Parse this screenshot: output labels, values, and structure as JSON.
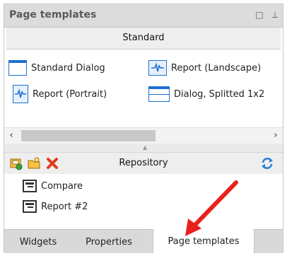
{
  "panel": {
    "title": "Page templates",
    "minimize_glyph": "□",
    "pin_glyph": "⊥"
  },
  "templates": {
    "category": "Standard",
    "items": [
      {
        "label": "Standard Dialog",
        "icon": "dialog-template-icon"
      },
      {
        "label": "Report (Landscape)",
        "icon": "report-landscape-icon"
      },
      {
        "label": "Report (Portrait)",
        "icon": "report-portrait-icon"
      },
      {
        "label": "Dialog, Splitted 1x2",
        "icon": "dialog-split-icon"
      }
    ]
  },
  "scrollbar": {
    "left_glyph": "‹",
    "right_glyph": "›"
  },
  "repository": {
    "title": "Repository",
    "items": [
      {
        "label": "Compare"
      },
      {
        "label": "Report #2"
      }
    ]
  },
  "tabs": [
    {
      "label": "Widgets",
      "active": false
    },
    {
      "label": "Properties",
      "active": false
    },
    {
      "label": "Page templates",
      "active": true
    }
  ],
  "colors": {
    "accent": "#1e6fd0",
    "annotation_arrow": "#e8221b"
  }
}
